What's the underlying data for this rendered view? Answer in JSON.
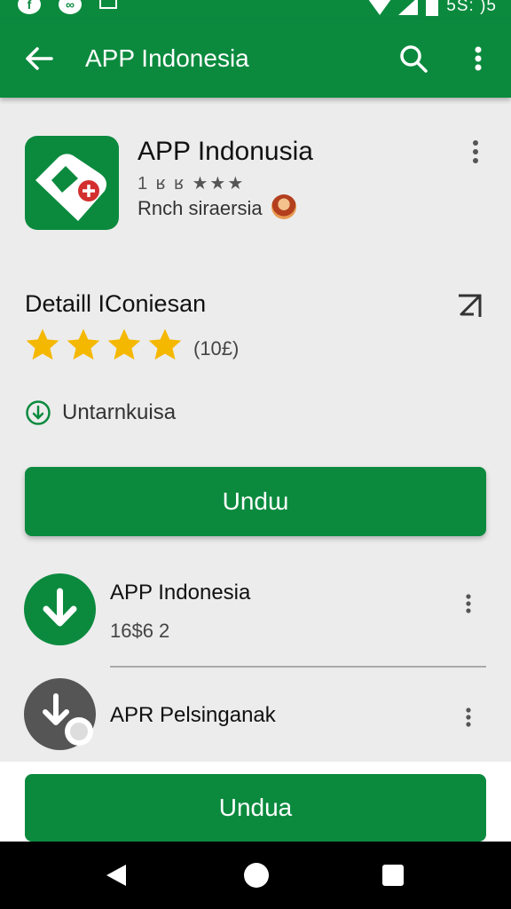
{
  "status_bar": {
    "time": "5S: )5"
  },
  "app_bar": {
    "title": "APP Indonesia"
  },
  "app": {
    "name": "APP Indonusia",
    "rating_line": "1 ʁ ʁ ★★★",
    "developer": "Rnch siraersia"
  },
  "details": {
    "title": "Detaill IConiesan",
    "rating": 4,
    "review_count": "(10£)",
    "download_label": "Untarnkuisa"
  },
  "primary_button": {
    "label": "Undɯ"
  },
  "list": [
    {
      "title": "APP Indonesia",
      "subtitle": "16$6 2"
    },
    {
      "title": "APR Pelsinganak",
      "subtitle": ""
    }
  ],
  "bottom_button": {
    "label": "Undua"
  },
  "colors": {
    "brand_green": "#0b8a3e",
    "star_yellow": "#f5b800",
    "background": "#ececec"
  },
  "icons": [
    "back-arrow-icon",
    "search-icon",
    "more-vert-icon",
    "share-icon",
    "download-icon",
    "star-icon"
  ]
}
